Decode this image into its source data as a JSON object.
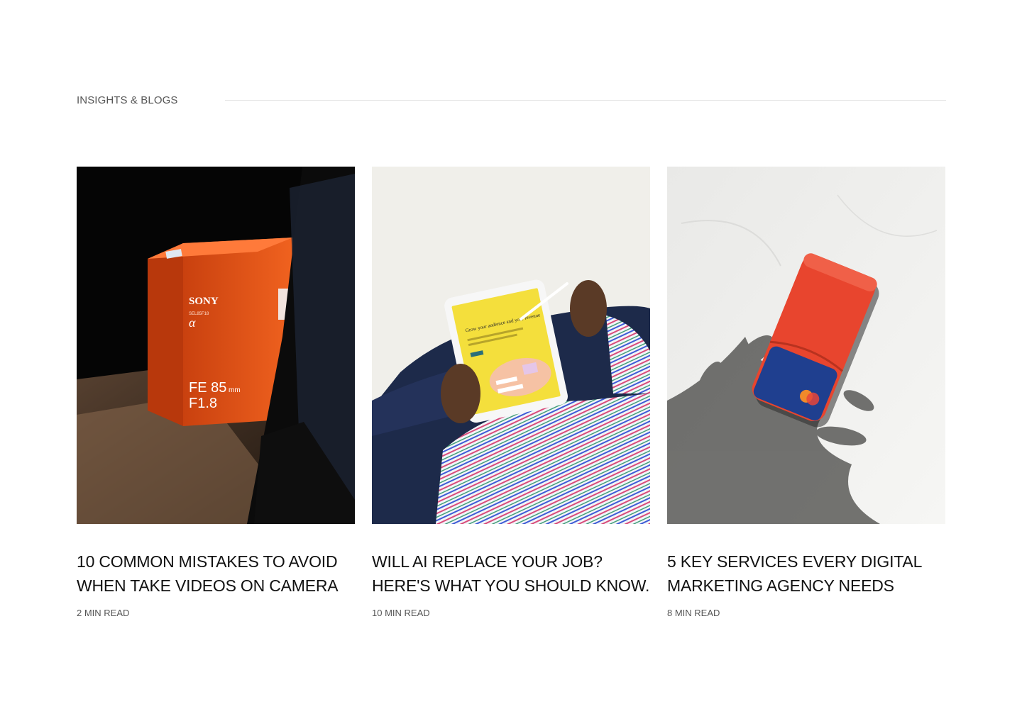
{
  "section": {
    "label": "INSIGHTS & BLOGS"
  },
  "cards": [
    {
      "title": "10 COMMON MISTAKES TO AVOID WHEN TAKE VIDEOS ON CAMERA",
      "read_time": "2 MIN READ",
      "image": {
        "box_brand": "SONY",
        "box_model": "FE 85",
        "box_unit": "mm",
        "box_aperture": "F1.8",
        "box_code": "SEL85F18",
        "box_alpha": "α"
      }
    },
    {
      "title": "WILL AI REPLACE YOUR JOB? HERE'S WHAT YOU SHOULD KNOW.",
      "read_time": "10 MIN READ",
      "image": {
        "screen_heading": "Grow your audience and your revenue"
      }
    },
    {
      "title": "5 KEY SERVICES EVERY DIGITAL MARKETING AGENCY NEEDS",
      "read_time": "8 MIN READ",
      "image": {}
    }
  ],
  "colors": {
    "text": "#111111",
    "muted": "#555555",
    "rule": "#e6e6e6",
    "box_orange": "#e8541a",
    "tablet_yellow": "#f4df3c",
    "wallet_red": "#e8452e",
    "card_blue": "#1f3f8f"
  }
}
